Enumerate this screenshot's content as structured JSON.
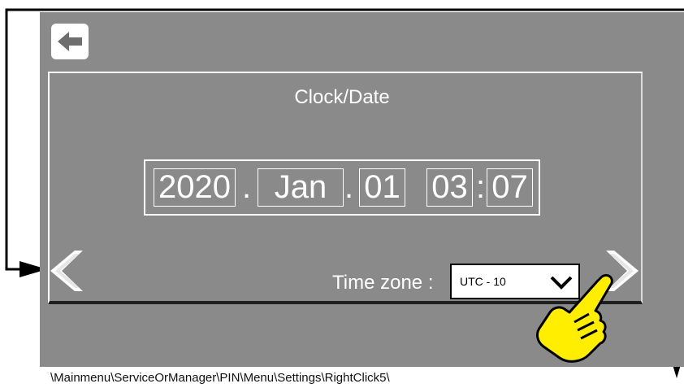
{
  "screen": {
    "title": "Clock/Date",
    "date": {
      "year": "2020",
      "separator_1": ".",
      "month": "Jan",
      "separator_2": ".",
      "day": "01",
      "hour": "03",
      "time_separator": ":",
      "minute": "07"
    },
    "time_zone": {
      "label": "Time zone :",
      "selected": "UTC - 10"
    }
  },
  "icons": {
    "back": "arrow-left-icon",
    "prev": "chevron-left-icon",
    "next": "chevron-right-icon",
    "dropdown": "chevron-down-icon",
    "pointer": "pointing-hand-icon"
  },
  "menu_path": "\\Mainmenu\\ServiceOrManager\\PIN\\Menu\\Settings\\RightClick5\\"
}
